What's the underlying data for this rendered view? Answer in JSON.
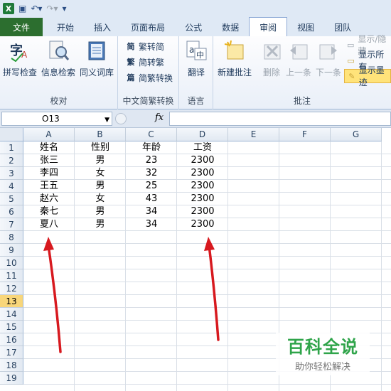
{
  "tabs": [
    "文件",
    "开始",
    "插入",
    "页面布局",
    "公式",
    "数据",
    "审阅",
    "视图",
    "团队"
  ],
  "active_tab": "审阅",
  "ribbon": {
    "proofing": {
      "label": "校对",
      "buttons": [
        "拼写检查",
        "信息检索",
        "同义词库"
      ]
    },
    "chinese": {
      "label": "中文简繁转换",
      "buttons": [
        "繁转简",
        "简转繁",
        "简繁转换"
      ]
    },
    "language": {
      "label": "语言",
      "buttons": [
        "翻译"
      ]
    },
    "comments": {
      "label": "批注",
      "buttons": [
        "新建批注",
        "删除",
        "上一条",
        "下一条"
      ],
      "right_buttons": [
        "显示/隐藏",
        "显示所有",
        "显示墨迹"
      ]
    }
  },
  "formula_bar": {
    "name_box": "O13",
    "fx": "fx",
    "value": ""
  },
  "columns": [
    "A",
    "B",
    "C",
    "D",
    "E",
    "F",
    "G"
  ],
  "rows": [
    "1",
    "2",
    "3",
    "4",
    "5",
    "6",
    "7",
    "8",
    "9",
    "10",
    "11",
    "12",
    "13",
    "14",
    "15",
    "16",
    "17",
    "18",
    "19"
  ],
  "selected_row": "13",
  "table": [
    [
      "姓名",
      "性别",
      "年龄",
      "工资"
    ],
    [
      "张三",
      "男",
      "23",
      "2300"
    ],
    [
      "李四",
      "女",
      "32",
      "2300"
    ],
    [
      "王五",
      "男",
      "25",
      "2300"
    ],
    [
      "赵六",
      "女",
      "43",
      "2300"
    ],
    [
      "秦七",
      "男",
      "34",
      "2300"
    ],
    [
      "夏八",
      "男",
      "34",
      "2300"
    ]
  ],
  "watermark": {
    "title": "百科全说",
    "subtitle": "助你轻松解决"
  },
  "colors": {
    "file_tab": "#2c6e2f",
    "arrow": "#d7191f",
    "selected_row": "#f8d67a",
    "watermark": "#2fa44a"
  }
}
